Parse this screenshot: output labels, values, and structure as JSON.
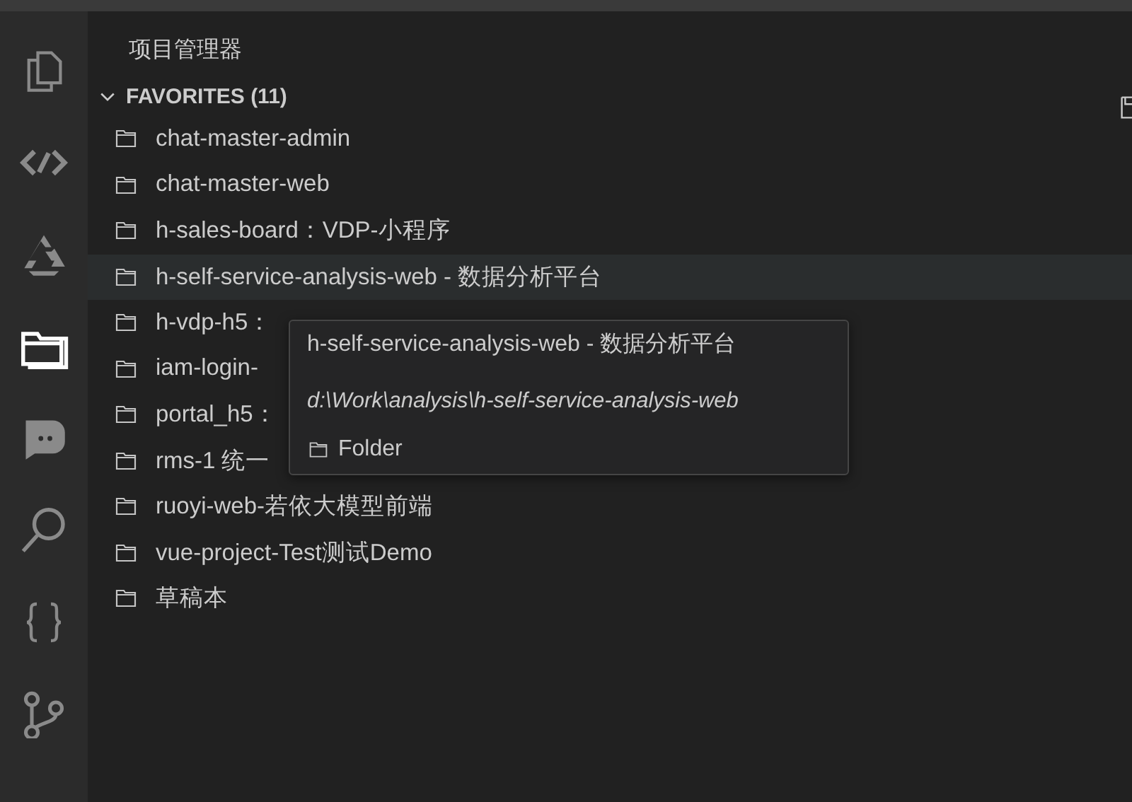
{
  "activity_bar": [
    {
      "selected": false
    },
    {
      "selected": false
    },
    {
      "selected": false
    },
    {
      "selected": true
    },
    {
      "selected": false
    },
    {
      "selected": false
    },
    {
      "selected": false
    },
    {
      "selected": false
    }
  ],
  "sidebar": {
    "title": "项目管理器",
    "section": {
      "label": "FAVORITES (11)",
      "expanded": true,
      "items": [
        {
          "label": "chat-master-admin",
          "hovered": false
        },
        {
          "label": "chat-master-web",
          "hovered": false
        },
        {
          "label": "h-sales-board：VDP-小程序",
          "hovered": false
        },
        {
          "label": "h-self-service-analysis-web - 数据分析平台",
          "hovered": true
        },
        {
          "label": "h-vdp-h5：",
          "hovered": false
        },
        {
          "label": "iam-login-",
          "hovered": false
        },
        {
          "label": "portal_h5：",
          "hovered": false
        },
        {
          "label": "rms-1 统一",
          "hovered": false
        },
        {
          "label": "ruoyi-web-若依大模型前端",
          "hovered": false
        },
        {
          "label": "vue-project-Test测试Demo",
          "hovered": false
        },
        {
          "label": "草稿本",
          "hovered": false
        }
      ]
    }
  },
  "tooltip": {
    "title": "h-self-service-analysis-web - 数据分析平台",
    "path": "d:\\Work\\analysis\\h-self-service-analysis-web",
    "kind_label": "Folder"
  }
}
